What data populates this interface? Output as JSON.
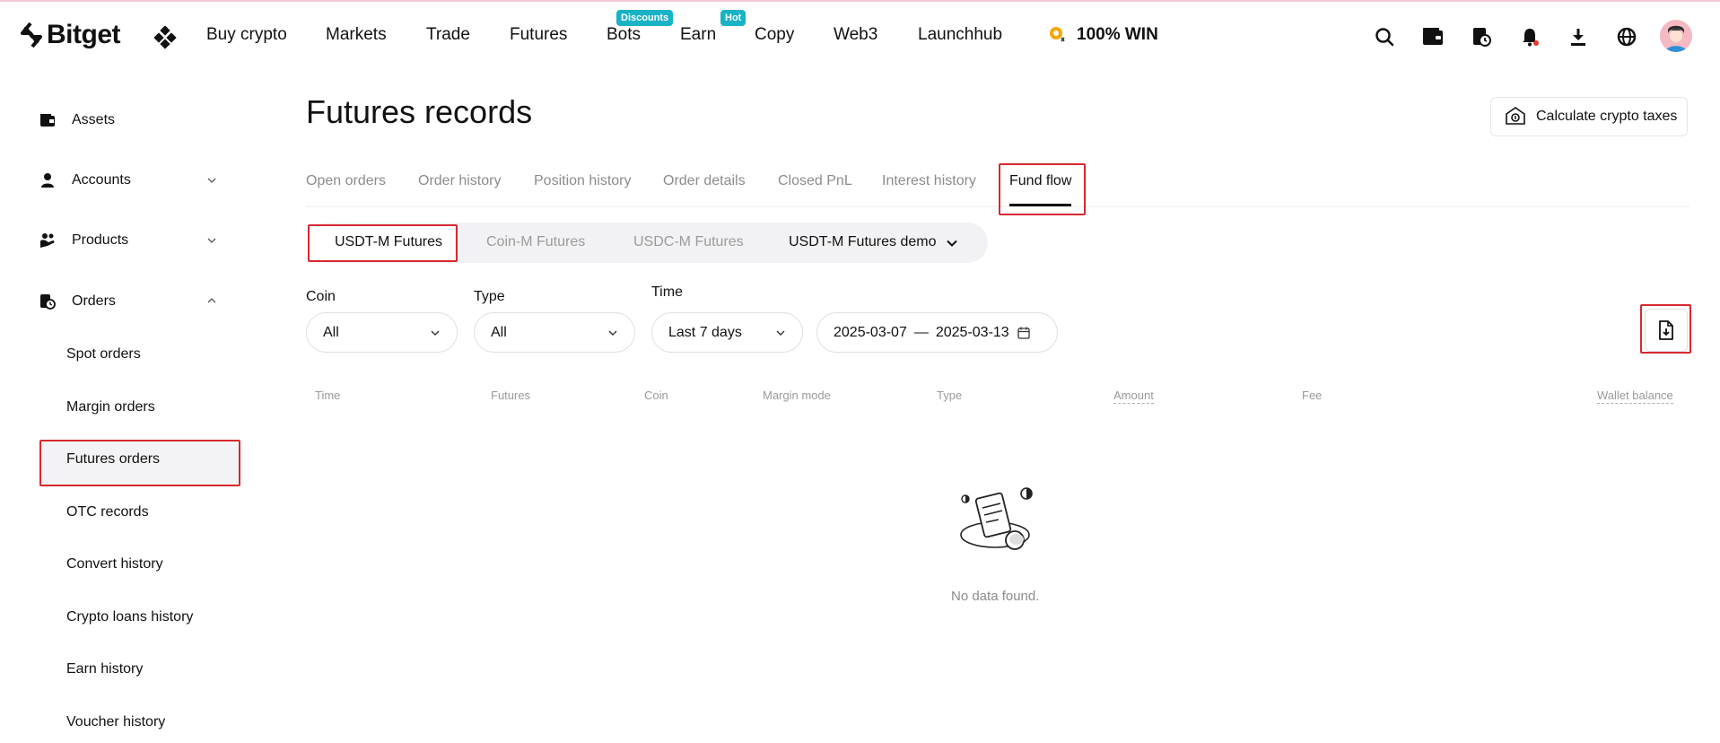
{
  "brand": {
    "name": "Bitget"
  },
  "nav": {
    "items": [
      {
        "label": "Buy crypto"
      },
      {
        "label": "Markets"
      },
      {
        "label": "Trade"
      },
      {
        "label": "Futures"
      },
      {
        "label": "Bots",
        "badge": "Discounts"
      },
      {
        "label": "Earn",
        "badge": "Hot"
      },
      {
        "label": "Copy"
      },
      {
        "label": "Web3"
      },
      {
        "label": "Launchhub"
      }
    ],
    "promo": "100% WIN",
    "right_icons": [
      "search-icon",
      "wallet-icon",
      "orders-icon",
      "bell-icon",
      "download-icon",
      "globe-icon"
    ],
    "badge_color": "#19b3c5"
  },
  "sidebar": {
    "items": [
      {
        "label": "Assets",
        "icon": "wallet-icon"
      },
      {
        "label": "Accounts",
        "icon": "user-icon"
      },
      {
        "label": "Products",
        "icon": "products-icon"
      },
      {
        "label": "Orders",
        "icon": "orders-icon"
      }
    ],
    "sub_items": [
      {
        "label": "Spot orders"
      },
      {
        "label": "Margin orders"
      },
      {
        "label": "Futures orders",
        "active": true
      },
      {
        "label": "OTC records"
      },
      {
        "label": "Convert history"
      },
      {
        "label": "Crypto loans history"
      },
      {
        "label": "Earn history"
      },
      {
        "label": "Voucher history"
      }
    ]
  },
  "main": {
    "title": "Futures records",
    "tax_button": "Calculate crypto taxes",
    "tabs": [
      {
        "label": "Open orders"
      },
      {
        "label": "Order history"
      },
      {
        "label": "Position history"
      },
      {
        "label": "Order details"
      },
      {
        "label": "Closed PnL"
      },
      {
        "label": "Interest history"
      },
      {
        "label": "Fund flow",
        "active": true
      }
    ],
    "segments": [
      {
        "label": "USDT-M Futures",
        "active": true
      },
      {
        "label": "Coin-M Futures"
      },
      {
        "label": "USDC-M Futures"
      },
      {
        "label": "USDT-M Futures demo"
      }
    ],
    "filters": {
      "coin": {
        "label": "Coin",
        "value": "All"
      },
      "type": {
        "label": "Type",
        "value": "All"
      },
      "time": {
        "label": "Time",
        "value": "Last 7 days"
      },
      "date_from": "2025-03-07",
      "date_sep": "—",
      "date_to": "2025-03-13"
    },
    "table": {
      "columns": [
        "Time",
        "Futures",
        "Coin",
        "Margin mode",
        "Type",
        "Amount",
        "Fee",
        "Wallet balance"
      ]
    },
    "empty_text": "No data found."
  },
  "colors": {
    "highlight_red": "#d8282f",
    "text": "#121212",
    "muted": "#8c8c8c"
  }
}
